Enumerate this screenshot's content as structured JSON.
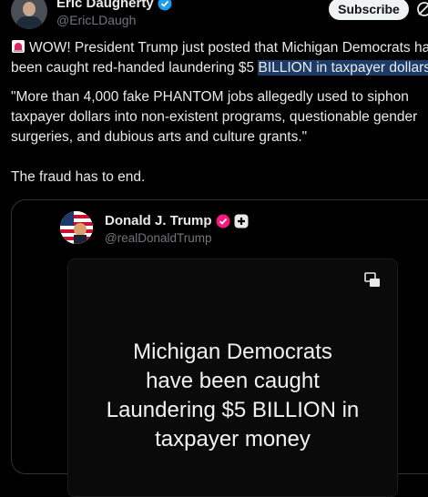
{
  "author": {
    "name": "Eric Daugherty",
    "handle": "@EricLDaugh"
  },
  "header": {
    "subscribe_label": "Subscribe"
  },
  "tweet": {
    "line1_text": "WOW! President Trump just posted that Michigan Democrats have",
    "line2_before": "been caught red-handed laundering $5 ",
    "line2_highlight": "BILLION in taxpayer dollars",
    "line2_after": ".",
    "para2_lines": [
      "\"More than 4,000 fake PHANTOM jobs allegedly used to siphon",
      "taxpayer dollars into non-existent programs, questionable gender",
      "surgeries, and dubious arts and culture grants.\""
    ],
    "para3": "The fraud has to end."
  },
  "quote": {
    "name": "Donald J. Trump",
    "handle": "@realDonaldTrump",
    "media_lines": [
      "Michigan Democrats",
      "have been caught",
      "Laundering $5 BILLION in",
      "taxpayer money"
    ]
  },
  "colors": {
    "verified": "#1d9bf0",
    "highlight": "#1d3b66",
    "trump_badge": "#f91880"
  },
  "icons": [
    "siren-icon",
    "verified-icon",
    "grok-icon",
    "media-icon",
    "plus-icon"
  ]
}
